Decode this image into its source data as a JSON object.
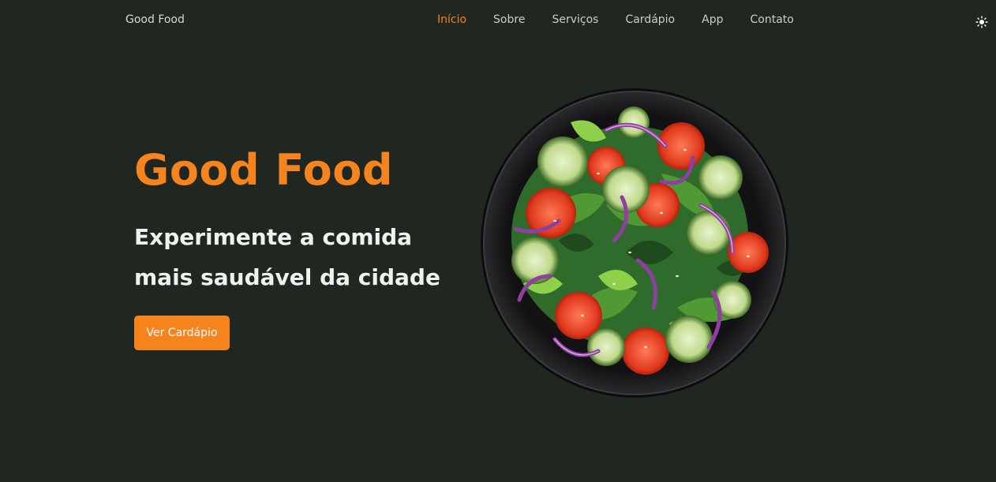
{
  "brand": {
    "name": "Good Food"
  },
  "nav": {
    "items": [
      {
        "label": "Início",
        "active": true
      },
      {
        "label": "Sobre"
      },
      {
        "label": "Serviços"
      },
      {
        "label": "Cardápio"
      },
      {
        "label": "App"
      },
      {
        "label": "Contato"
      }
    ]
  },
  "hero": {
    "title": "Good Food",
    "subtitle_line1": "Experimente a comida",
    "subtitle_line2": "mais saudável da cidade",
    "cta_label": "Ver Cardápio"
  },
  "icons": {
    "theme_toggle": "sun-icon"
  },
  "colors": {
    "background": "#1f2720",
    "accent": "#f5841f",
    "text_light": "#f0f2f0",
    "nav_text": "#c9cfc9"
  }
}
